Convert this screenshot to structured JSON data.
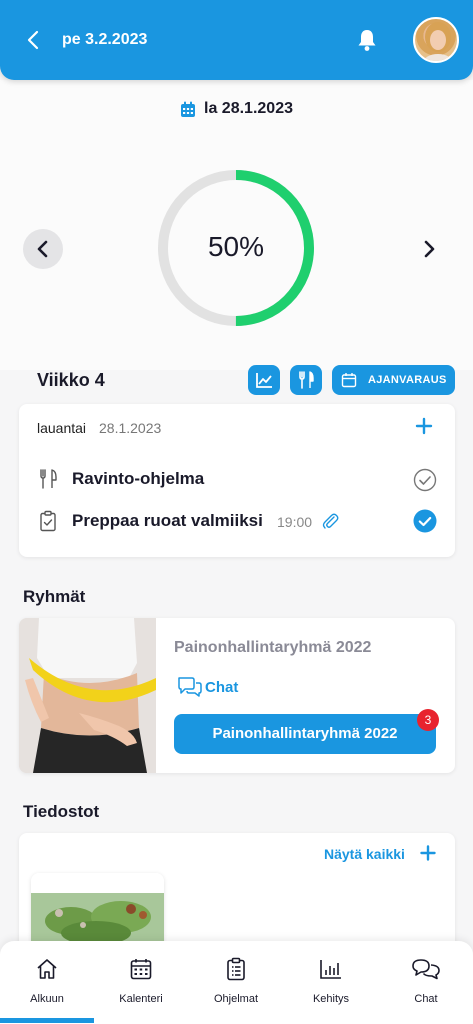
{
  "header": {
    "title": "pe 3.2.2023",
    "back_icon": "chevron-left-icon",
    "bell_icon": "bell-icon",
    "avatar": "user-avatar"
  },
  "day_view": {
    "date": "la 28.1.2023",
    "progress_text": "50%",
    "progress_fraction": 0.5
  },
  "week": {
    "label": "Viikko 4",
    "booking_label": "AJANVARAUS"
  },
  "day_card": {
    "day_name": "lauantai",
    "date": "28.1.2023",
    "tasks": [
      {
        "title": "Ravinto-ohjelma",
        "time": "",
        "icon": "utensils-icon",
        "done": false
      },
      {
        "title": "Preppaa ruoat valmiiksi",
        "time": "19:00",
        "icon": "clipboard-check-icon",
        "done": true
      }
    ]
  },
  "groups": {
    "title": "Ryhmät",
    "name": "Painonhallintaryhmä 2022",
    "chat_label": "Chat",
    "button_label": "Painonhallintaryhmä 2022",
    "badge_count": "3"
  },
  "files": {
    "title": "Tiedostot",
    "show_all": "Näytä kaikki"
  },
  "nav": {
    "items": [
      {
        "label": "Alkuun",
        "icon": "home-icon",
        "active": true
      },
      {
        "label": "Kalenteri",
        "icon": "calendar-icon",
        "active": false
      },
      {
        "label": "Ohjelmat",
        "icon": "clipboard-list-icon",
        "active": false
      },
      {
        "label": "Kehitys",
        "icon": "bar-chart-icon",
        "active": false
      },
      {
        "label": "Chat",
        "icon": "chat-bubbles-icon",
        "active": false
      }
    ]
  },
  "colors": {
    "primary": "#1a96e0",
    "progress": "#1fcf6e",
    "track": "#e2e2e2",
    "badge": "#e8232e"
  }
}
